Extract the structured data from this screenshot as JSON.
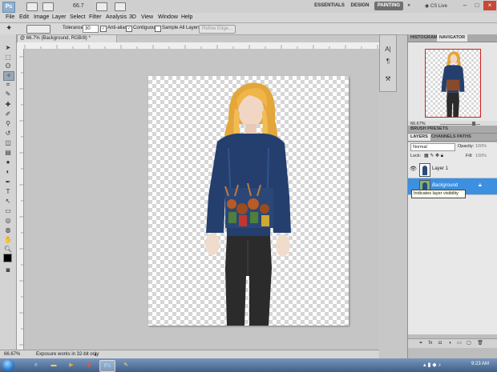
{
  "app": {
    "logo": "Ps",
    "zoom_display": "66.7",
    "workspaces": [
      "ESSENTIALS",
      "DESIGN",
      "PAINTING"
    ],
    "active_workspace": "PAINTING",
    "more": "»",
    "cs_live": "CS Live",
    "window_controls": [
      "–",
      "□",
      "×"
    ]
  },
  "menu": [
    "File",
    "Edit",
    "Image",
    "Layer",
    "Select",
    "Filter",
    "Analysis",
    "3D",
    "View",
    "Window",
    "Help"
  ],
  "options_bar": {
    "tolerance_label": "Tolerance:",
    "tolerance_value": "30",
    "anti_alias": "Anti-alias",
    "contiguous": "Contiguous",
    "sample_all_layers": "Sample All Layers",
    "refine_edge": "Refine Edge..."
  },
  "document": {
    "tab_title": "@ 66.7% (Background, RGB/8) *",
    "status_zoom": "66.67%",
    "status_text": "Exposure works in 32-bit only"
  },
  "panels": {
    "navigator_tabs": [
      "HISTOGRAM",
      "NAVIGATOR"
    ],
    "navigator_zoom": "66.67%",
    "brush_presets": "BRUSH PRESETS",
    "layers_tabs": [
      "LAYERS",
      "CHANNELS",
      "PATHS"
    ],
    "blend_mode": "Normal",
    "opacity_label": "Opacity:",
    "opacity_value": "100%",
    "lock_label": "Lock:",
    "fill_label": "Fill:",
    "fill_value": "100%",
    "layers": [
      {
        "name": "Layer 1",
        "selected": false,
        "visible": true
      },
      {
        "name": "Background",
        "selected": true,
        "visible": false
      }
    ],
    "tooltip": "Indicates layer visibility"
  },
  "taskbar": {
    "time": "9:23 AM",
    "apps": [
      "IE",
      "Explorer",
      "Media",
      "Chrome",
      "Ps",
      "Paint"
    ]
  },
  "colors": {
    "selection_blue": "#3d8fe0",
    "accent_active_tab": "#6f6f6f"
  }
}
